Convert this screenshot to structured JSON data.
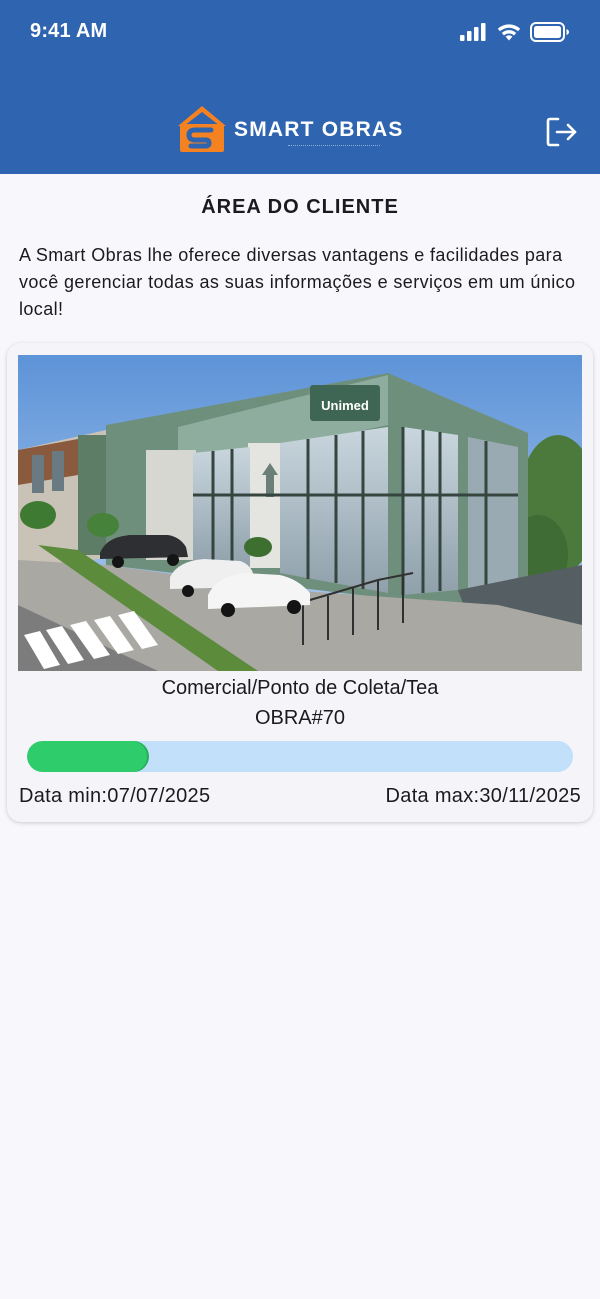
{
  "status_bar": {
    "time": "9:41 AM"
  },
  "header": {
    "brand_name": "SMART OBRAS",
    "brand_color": "#2e64b0",
    "logo_accent_color": "#f58220",
    "logout_icon": "logout-icon"
  },
  "page": {
    "title": "ÁREA DO CLIENTE",
    "intro": "A Smart Obras lhe oferece diversas vantagens e facilidades para você gerenciar todas as suas informações e serviços em um único local!"
  },
  "project": {
    "image_signage": "Unimed",
    "name": "Comercial/Ponto de Coleta/Tea",
    "code": "OBRA#70",
    "progress_fraction": 0.22,
    "progress_color": "#2ecc6a",
    "progress_track_color": "#c2e0f9",
    "date_min_label": "Data min:",
    "date_min_value": "07/07/2025",
    "date_max_label": "Data max:",
    "date_max_value": "30/11/2025"
  }
}
